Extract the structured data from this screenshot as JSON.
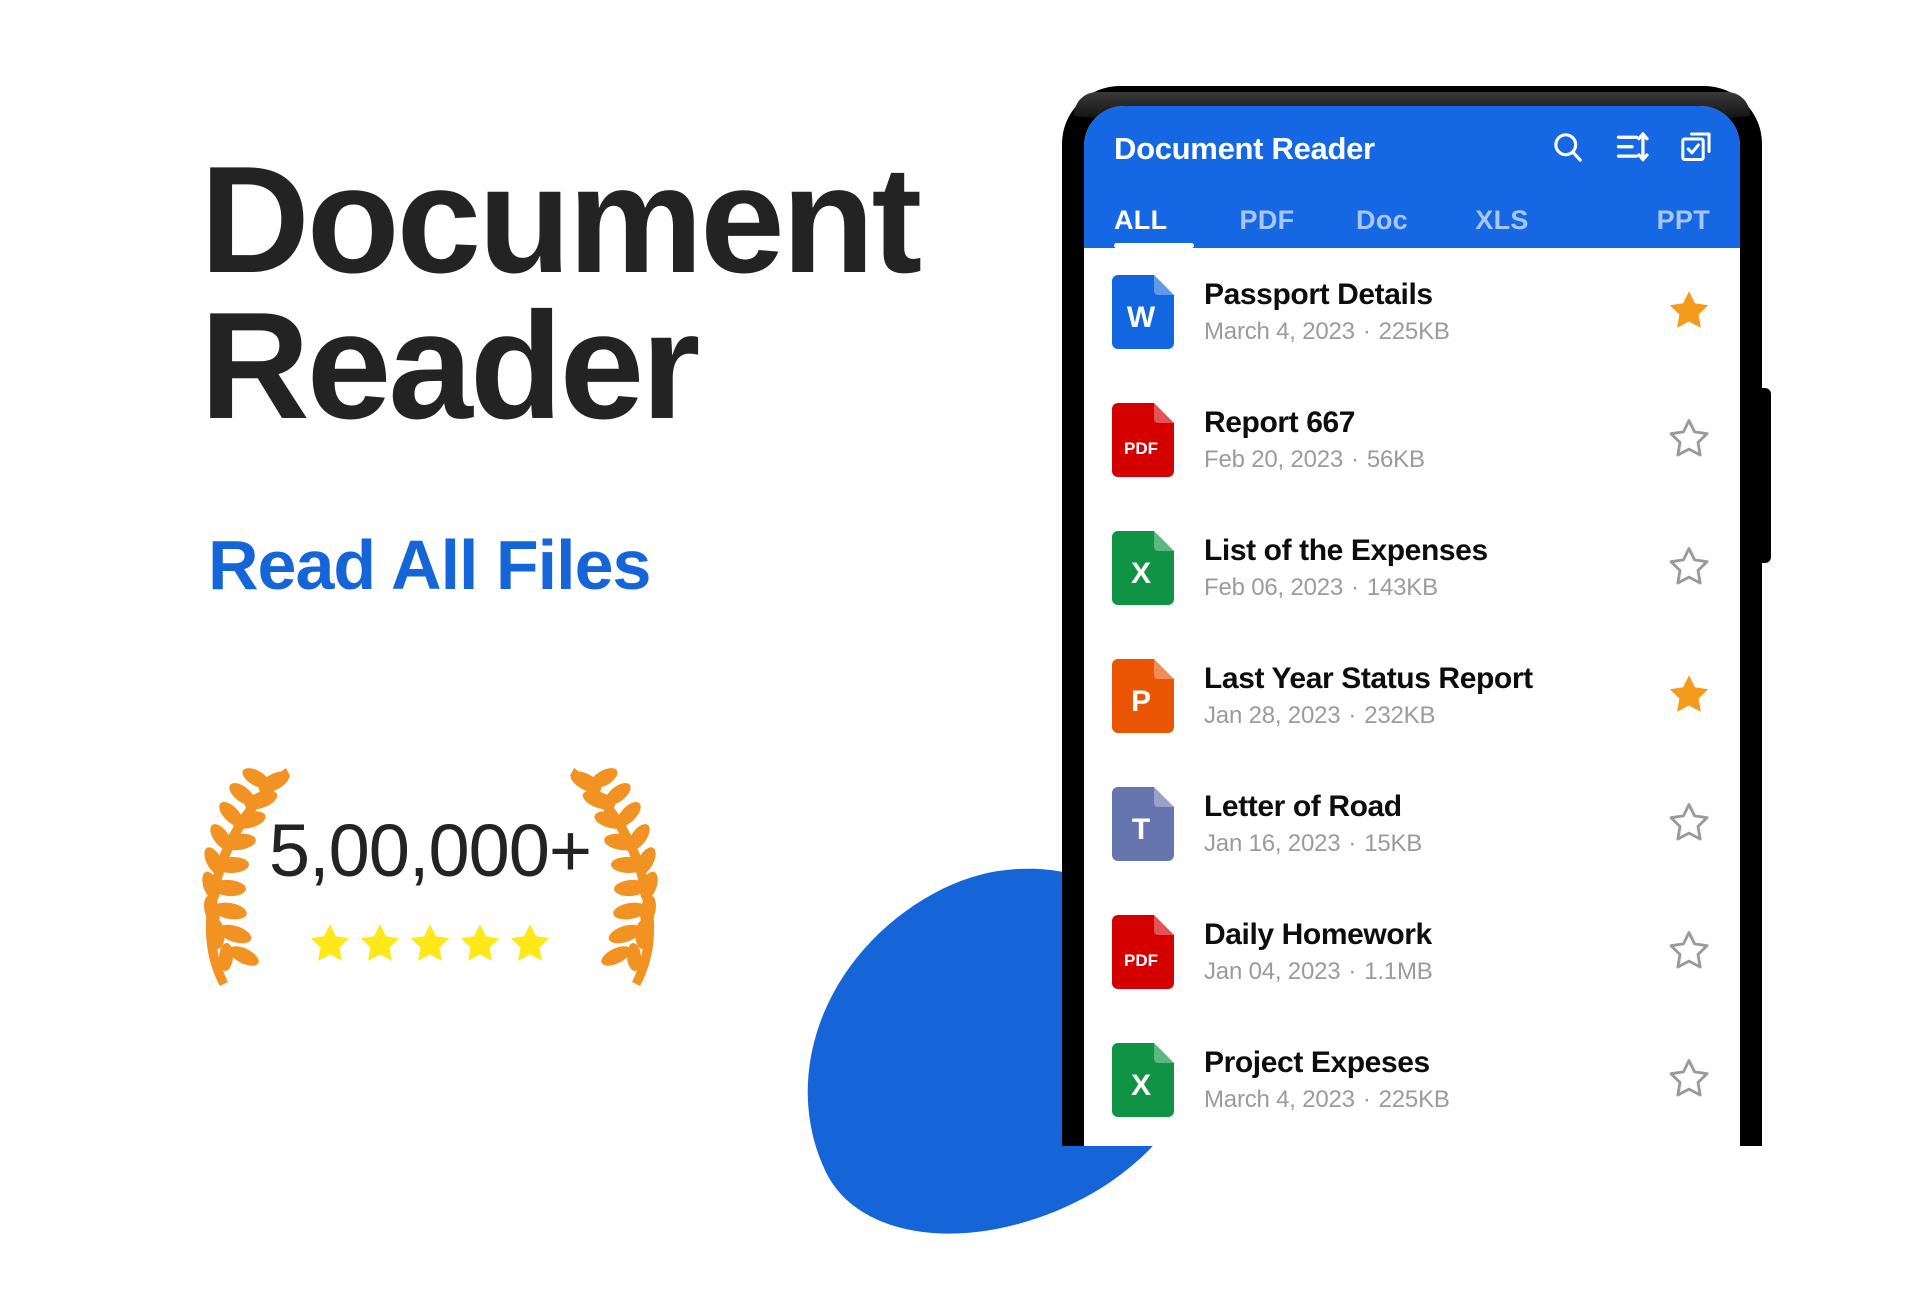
{
  "promo": {
    "title_line1": "Document",
    "title_line2": "Reader",
    "subtitle": "Read All Files",
    "badge": {
      "count": "5,00,000+",
      "stars": 5,
      "star_color": "#FFE81A",
      "laurel_color": "#F29222"
    },
    "colors": {
      "title": "#232323",
      "subtitle": "#1565D8",
      "blob": "#1565D8"
    }
  },
  "phone": {
    "appbar": {
      "title": "Document Reader",
      "bg_color": "#1567E3",
      "icons": [
        {
          "name": "search-icon",
          "label": "Search"
        },
        {
          "name": "sort-icon",
          "label": "Sort"
        },
        {
          "name": "multi-select-icon",
          "label": "Select"
        }
      ]
    },
    "tabs": [
      {
        "label": "ALL",
        "active": true
      },
      {
        "label": "PDF",
        "active": false
      },
      {
        "label": "Doc",
        "active": false
      },
      {
        "label": "XLS",
        "active": false
      },
      {
        "label": "PPT",
        "active": false
      }
    ],
    "files": [
      {
        "name": "Passport Details",
        "date": "March 4, 2023",
        "size": "225KB",
        "type": "doc",
        "badge": "W",
        "color": "#1266E0",
        "starred": true
      },
      {
        "name": "Report 667",
        "date": "Feb 20, 2023",
        "size": "56KB",
        "type": "pdf",
        "badge": "PDF",
        "color": "#D40000",
        "starred": false
      },
      {
        "name": "List of the Expenses",
        "date": "Feb 06, 2023",
        "size": "143KB",
        "type": "xls",
        "badge": "X",
        "color": "#0E9444",
        "starred": false
      },
      {
        "name": "Last Year Status Report",
        "date": "Jan 28, 2023",
        "size": "232KB",
        "type": "ppt",
        "badge": "P",
        "color": "#EA5504",
        "starred": true
      },
      {
        "name": "Letter of Road",
        "date": "Jan 16, 2023",
        "size": "15KB",
        "type": "txt",
        "badge": "T",
        "color": "#6675AD",
        "starred": false
      },
      {
        "name": "Daily Homework",
        "date": "Jan 04, 2023",
        "size": "1.1MB",
        "type": "pdf",
        "badge": "PDF",
        "color": "#D40000",
        "starred": false
      },
      {
        "name": "Project Expeses",
        "date": "March 4, 2023",
        "size": "225KB",
        "type": "xls",
        "badge": "X",
        "color": "#0E9444",
        "starred": false
      }
    ],
    "separator": "·",
    "star_filled_color": "#F59B1C",
    "star_empty_color": "#9a9a9a"
  }
}
